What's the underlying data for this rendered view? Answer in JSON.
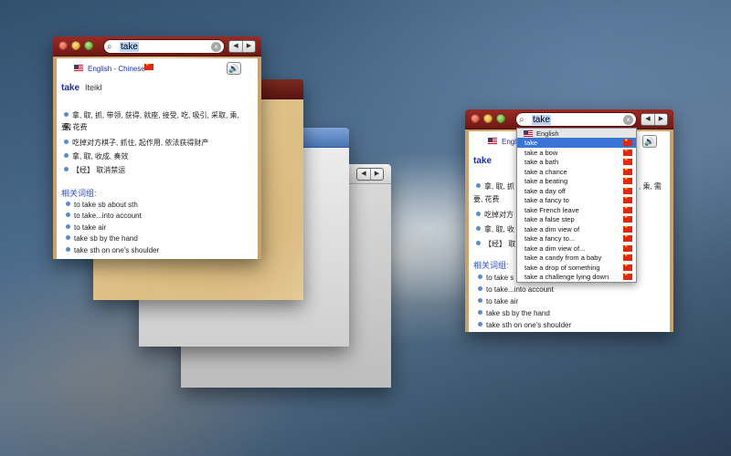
{
  "search": {
    "query": "take"
  },
  "dict": {
    "lang_pair": "English - Chinese",
    "lang_pair_short": "Englis",
    "headword": "take",
    "phonetic": "Iteikl",
    "definitions": [
      "拿, 取, 抓, 带领, 获得, 就座, 接受, 吃, 吸引, 采取, 乘, 需",
      "要, 花费",
      "吃掉对方棋子, 抓住, 起作用, 依法获得财产",
      "拿, 取, 收成, 奏效",
      "【经】 取消禁运"
    ],
    "related_title": "相关词组:",
    "phrases": [
      "to take sb about sth",
      "to take...into account",
      "to take air",
      "take sb by the hand",
      "take sth on one's shoulder"
    ]
  },
  "right_window": {
    "defs_visible": [
      "拿, 取, 抓",
      ", 乘, 需",
      "要, 花费",
      "吃掉对方",
      "拿, 取, 收",
      "【经】 取"
    ],
    "related_title_short": "相关词组:",
    "phrases_short": [
      "to take s",
      "to take...into account",
      "to take air",
      "take sb by the hand",
      "take sth on one's shoulder"
    ]
  },
  "suggestions": {
    "header": "English",
    "items": [
      "take",
      "take a bow",
      "take a bath",
      "take a chance",
      "take a beating",
      "take a day off",
      "take a fancy to",
      "take French leave",
      "take a false step",
      "take a dim view of",
      "take a fancy to...",
      "take a dim view of...",
      "take a candy from a baby",
      "take a drop of something",
      "take a challenge lying down"
    ]
  },
  "icons": {
    "speaker": "speaker-icon",
    "search": "search-icon",
    "clear": "clear-icon"
  }
}
